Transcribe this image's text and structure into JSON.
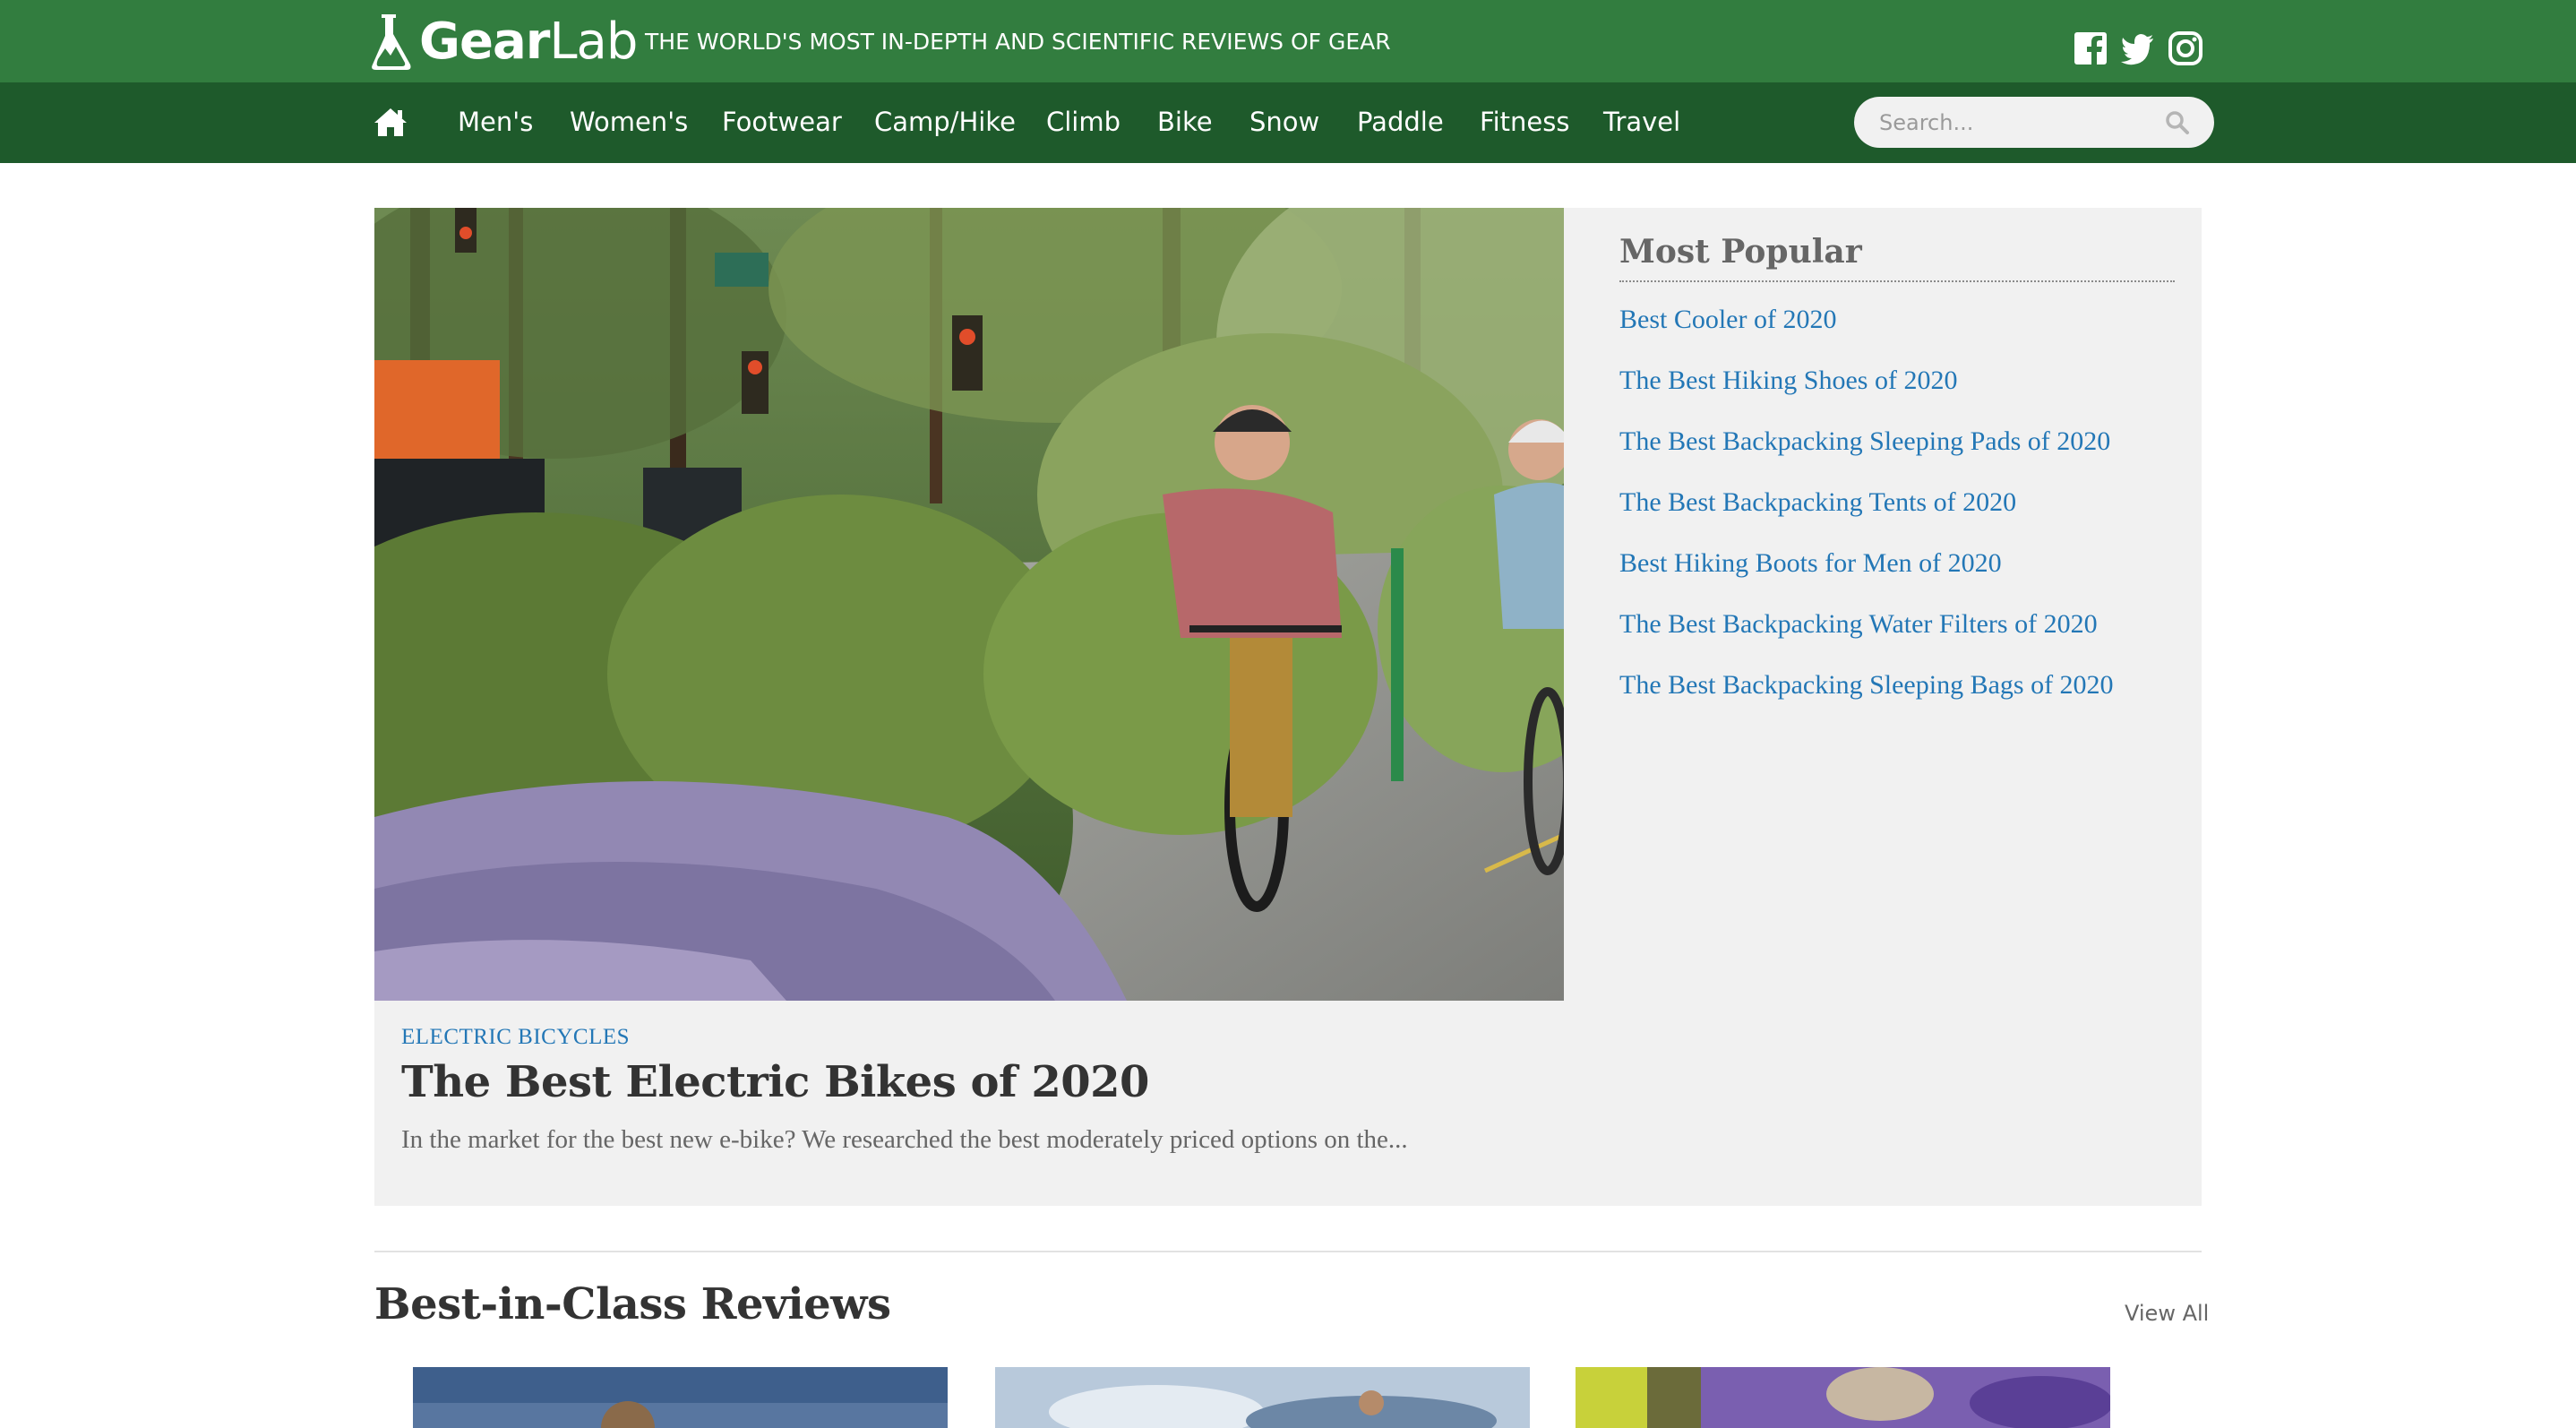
{
  "header": {
    "logo_gear": "Gear",
    "logo_lab": "Lab",
    "tagline": "THE WORLD'S MOST IN-DEPTH AND SCIENTIFIC REVIEWS OF GEAR",
    "social_icons": [
      "facebook-icon",
      "twitter-icon",
      "instagram-icon"
    ]
  },
  "nav": {
    "home_icon": "home-icon",
    "items": [
      "Men's",
      "Women's",
      "Footwear",
      "Camp/Hike",
      "Climb",
      "Bike",
      "Snow",
      "Paddle",
      "Fitness",
      "Travel"
    ],
    "search_placeholder": "Search...",
    "search_icon": "search-icon"
  },
  "featured": {
    "category": "ELECTRIC BICYCLES",
    "title": "The Best Electric Bikes of 2020",
    "description": "In the market for the best new e-bike? We researched the best moderately priced options on the..."
  },
  "popular": {
    "title": "Most Popular",
    "links": [
      "Best Cooler of 2020",
      "The Best Hiking Shoes of 2020",
      "The Best Backpacking Sleeping Pads of 2020",
      "The Best Backpacking Tents of 2020",
      "Best Hiking Boots for Men of 2020",
      "The Best Backpacking Water Filters of 2020",
      "The Best Backpacking Sleeping Bags of 2020"
    ]
  },
  "best_in_class": {
    "title": "Best-in-Class Reviews",
    "view_all": "View All"
  },
  "colors": {
    "header_green": "#327d3f",
    "nav_green": "#1e5a2b",
    "link_blue": "#2377b6",
    "panel_gray": "#f1f1f1"
  }
}
